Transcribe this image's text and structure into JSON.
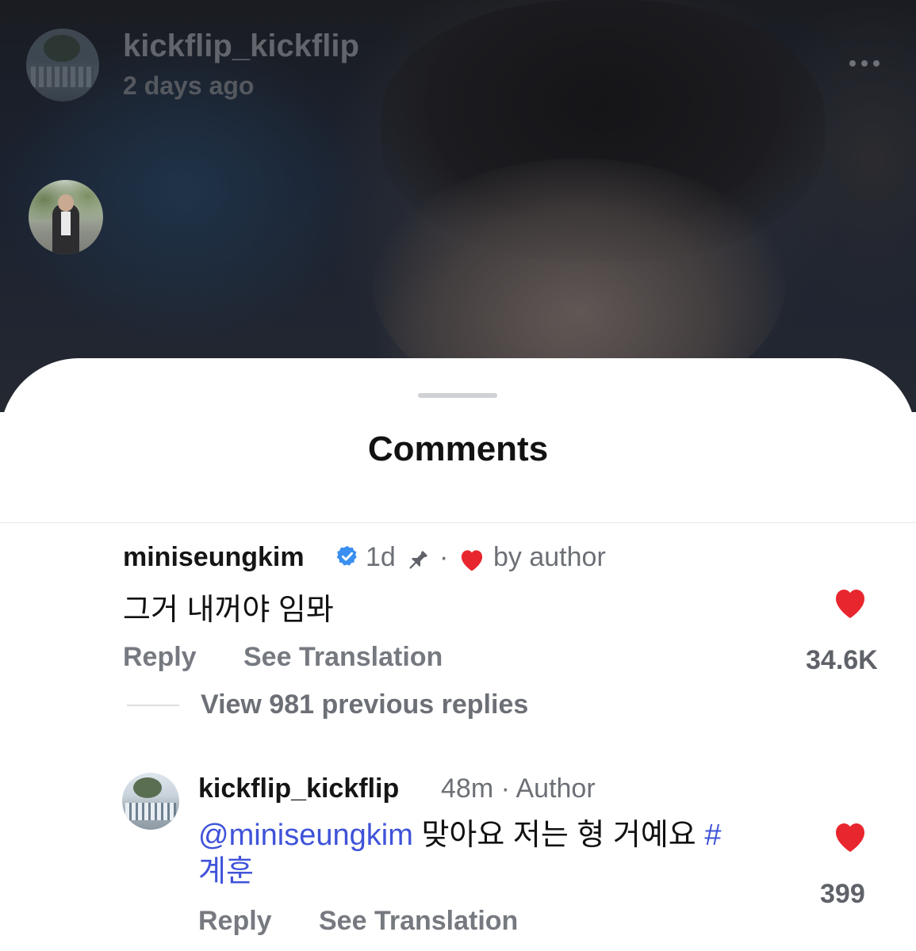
{
  "post": {
    "username": "kickflip_kickflip",
    "time": "2 days ago",
    "more_icon": "ellipsis-icon"
  },
  "sheet": {
    "title": "Comments"
  },
  "comment": {
    "username": "miniseungkim",
    "verified_icon": "verified-badge-icon",
    "time": "1d",
    "pin_icon": "pin-icon",
    "separator": "·",
    "liked_by": "by author",
    "text": "그거 내꺼야 임뫄",
    "reply_label": "Reply",
    "translate_label": "See Translation",
    "like_count": "34.6K"
  },
  "thread": {
    "view_replies": "View 981 previous replies"
  },
  "reply": {
    "username": "kickflip_kickflip",
    "meta": "48m · Author",
    "mention": "@miniseungkim",
    "text": " 맞아요 저는 형 거예요 ",
    "hashtag_line1": "#",
    "hashtag_line2": "계훈",
    "reply_label": "Reply",
    "translate_label": "See Translation",
    "like_count": "399"
  },
  "colors": {
    "like": "#e8262e",
    "verified": "#3a8ff0",
    "link": "#3f53d9"
  }
}
